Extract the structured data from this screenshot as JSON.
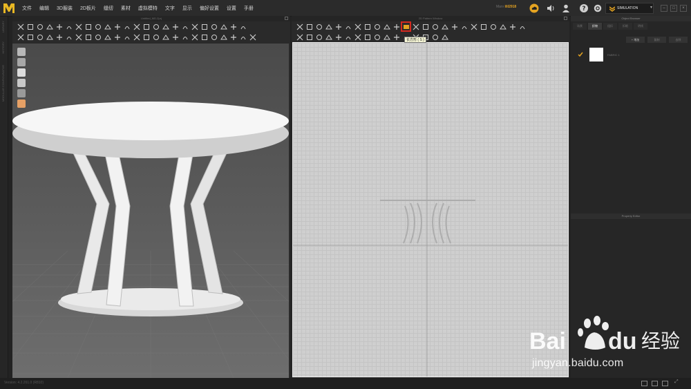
{
  "app": {
    "logo": "M",
    "version_text": "Version: 4.2.261.0 (R810)"
  },
  "menu": [
    "文件",
    "编辑",
    "3D服装",
    "2D板片",
    "缝纫",
    "素材",
    "虚拟模特",
    "文字",
    "显示",
    "偏好设置",
    "设置",
    "手册"
  ],
  "user": {
    "prefix": "Marv",
    "name": "ilil2918"
  },
  "simulation_label": "SIMULATION",
  "window3d": {
    "title": "Untitled_MD.Zprj"
  },
  "window2d": {
    "title": "2D Pattern Window"
  },
  "tooltip": "长方形 ( S )",
  "side_tabs": [
    "LIBRARY",
    "HISTORY",
    "MODULAR CONFIGURATOR"
  ],
  "object_browser": {
    "title": "Object Browser",
    "tabs": [
      "场景",
      "织物",
      "纽扣",
      "扣眼",
      "明线"
    ],
    "active_tab": 1,
    "buttons": {
      "add": "+ 增加",
      "copy": "复制",
      "delete": "去除"
    },
    "item_name": "FABRIC 1"
  },
  "property_editor": {
    "title": "Property Editor"
  },
  "watermark": {
    "brand": "Bai du 经验",
    "url": "jingyan.baidu.com"
  },
  "colors": {
    "accent": "#e4a321",
    "highlight_red": "#d42a1f",
    "canvas": "#cfcfcf"
  }
}
